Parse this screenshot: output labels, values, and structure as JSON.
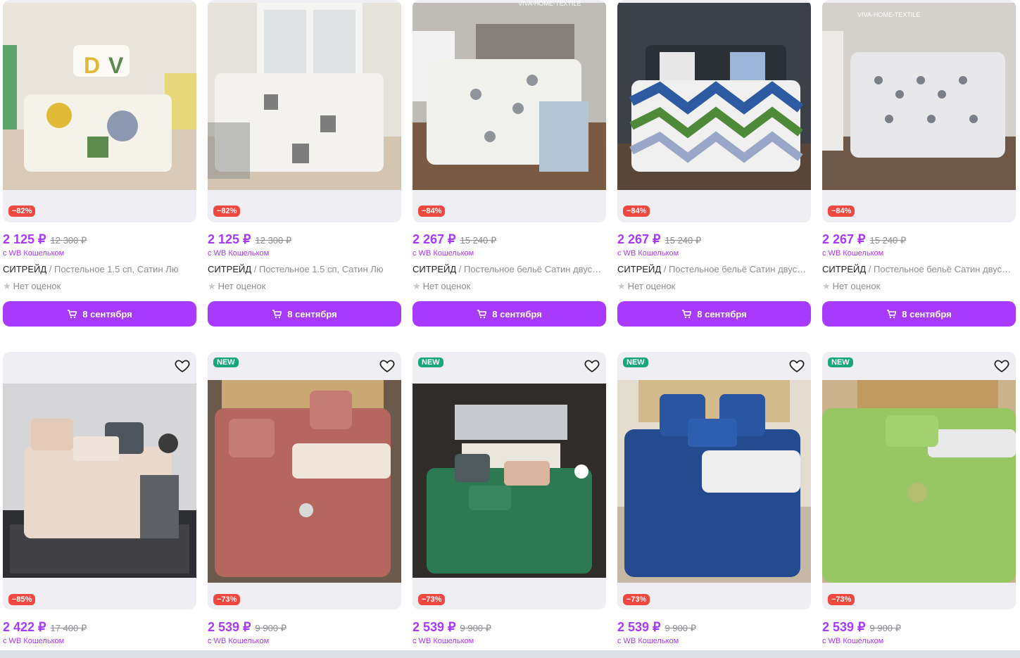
{
  "products_row1": [
    {
      "discount": "−82%",
      "price": "2 125 ₽",
      "old_price": "12 300 ₽",
      "wallet": "с WB Кошельком",
      "brand": "СИТРЕЙД",
      "name": " / Постельное 1.5 сп, Сатин Лю",
      "rating": "Нет оценок",
      "button": "8 сентября"
    },
    {
      "discount": "−82%",
      "price": "2 125 ₽",
      "old_price": "12 300 ₽",
      "wallet": "с WB Кошельком",
      "brand": "СИТРЕЙД",
      "name": " / Постельное 1.5 сп, Сатин Лю",
      "rating": "Нет оценок",
      "button": "8 сентября"
    },
    {
      "discount": "−84%",
      "price": "2 267 ₽",
      "old_price": "15 240 ₽",
      "wallet": "с WB Кошельком",
      "brand": "СИТРЕЙД",
      "name": " / Постельное бельё Сатин двуспальное",
      "rating": "Нет оценок",
      "button": "8 сентября"
    },
    {
      "discount": "−84%",
      "price": "2 267 ₽",
      "old_price": "15 240 ₽",
      "wallet": "с WB Кошельком",
      "brand": "СИТРЕЙД",
      "name": " / Постельное бельё Сатин двуспальное",
      "rating": "Нет оценок",
      "button": "8 сентября"
    },
    {
      "discount": "−84%",
      "price": "2 267 ₽",
      "old_price": "15 240 ₽",
      "wallet": "с WB Кошельком",
      "brand": "СИТРЕЙД",
      "name": " / Постельное бельё Сатин двуспальное",
      "rating": "Нет оценок",
      "button": "8 сентября"
    }
  ],
  "products_row2": [
    {
      "new": "",
      "discount": "−85%",
      "price": "2 422 ₽",
      "old_price": "17 400 ₽",
      "wallet": "с WB Кошельком"
    },
    {
      "new": "NEW",
      "discount": "−73%",
      "price": "2 539 ₽",
      "old_price": "9 900 ₽",
      "wallet": "с WB Кошельком"
    },
    {
      "new": "NEW",
      "discount": "−73%",
      "price": "2 539 ₽",
      "old_price": "9 900 ₽",
      "wallet": "с WB Кошельком"
    },
    {
      "new": "NEW",
      "discount": "−73%",
      "price": "2 539 ₽",
      "old_price": "9 900 ₽",
      "wallet": "с WB Кошельком"
    },
    {
      "new": "NEW",
      "discount": "−73%",
      "price": "2 539 ₽",
      "old_price": "9 900 ₽",
      "wallet": "с WB Кошельком"
    }
  ],
  "watermarks": [
    "VIVA-HOME-TEXTILE",
    "VIVA-HOME-TEXTILE"
  ],
  "icons": {
    "cart": "cart-icon",
    "favorite": "heart-icon",
    "star": "star-icon"
  },
  "colors": {
    "accent": "#a73afd",
    "discount": "#f0473f",
    "new": "#17a77b",
    "card_bg": "#efeef3"
  }
}
